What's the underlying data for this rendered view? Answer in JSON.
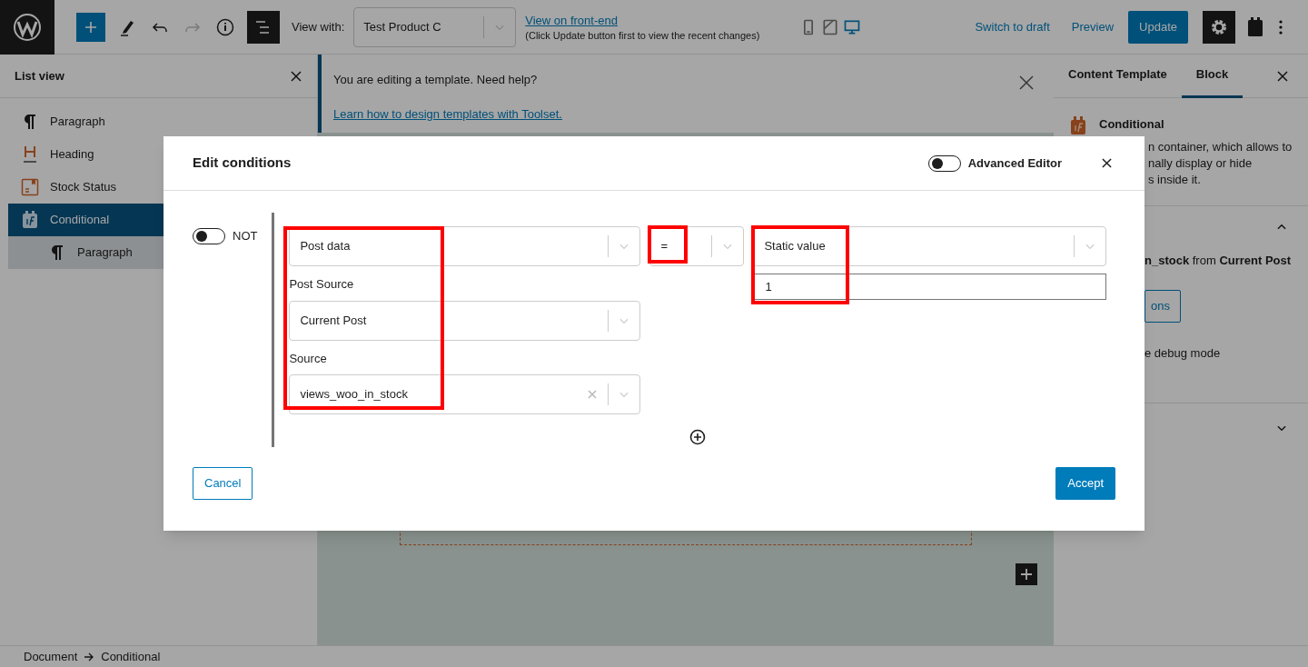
{
  "topbar": {
    "list_view_selected": true,
    "view_with": {
      "label": "View with:",
      "value": "Test Product C"
    },
    "front_end_link": "View on front-end",
    "front_end_note": "(Click Update button first to view the recent changes)",
    "devices": [
      {
        "kind": "mobile",
        "selected": false
      },
      {
        "kind": "tablet",
        "selected": false
      },
      {
        "kind": "desktop",
        "selected": true
      }
    ],
    "switch_to_draft": "Switch to draft",
    "preview": "Preview",
    "update": "Update",
    "settings_selected": true
  },
  "list_view": {
    "title": "List view",
    "items": [
      {
        "label": "Paragraph",
        "kind": "paragraph",
        "selected": false
      },
      {
        "label": "Heading",
        "kind": "heading",
        "selected": false
      },
      {
        "label": "Stock Status",
        "kind": "stock",
        "selected": false
      },
      {
        "label": "Conditional",
        "kind": "conditional",
        "selected": true,
        "children": [
          {
            "label": "Paragraph",
            "kind": "paragraph",
            "selected": false
          }
        ]
      }
    ]
  },
  "notice": {
    "text": "You are editing a template. Need help?",
    "link": "Learn how to design templates with Toolset."
  },
  "sidebar": {
    "tabs": [
      {
        "label": "Content Template",
        "selected": false
      },
      {
        "label": "Block",
        "selected": true
      }
    ],
    "block_title": "Conditional",
    "description_lines": [
      "n container, which allows to",
      "nally display or hide",
      "s inside it."
    ],
    "source_text": "**n_stock** from **Current Post**",
    "button": "ons",
    "debug_text": "e debug mode"
  },
  "modal": {
    "title": "Edit conditions",
    "advanced_editor": {
      "label": "Advanced Editor",
      "on": false
    },
    "not": {
      "label": "NOT",
      "on": false
    },
    "left": {
      "value": "Post data",
      "highlighted": true,
      "post_source_label": "Post Source",
      "post_source": "Current Post",
      "source_label": "Source",
      "source": "views_woo_in_stock"
    },
    "operator": {
      "value": "=",
      "highlighted": true
    },
    "right": {
      "value": "Static value",
      "input": "1",
      "highlighted": true
    },
    "cancel": "Cancel",
    "accept": "Accept"
  },
  "breadcrumb": [
    "Document",
    "Conditional"
  ]
}
